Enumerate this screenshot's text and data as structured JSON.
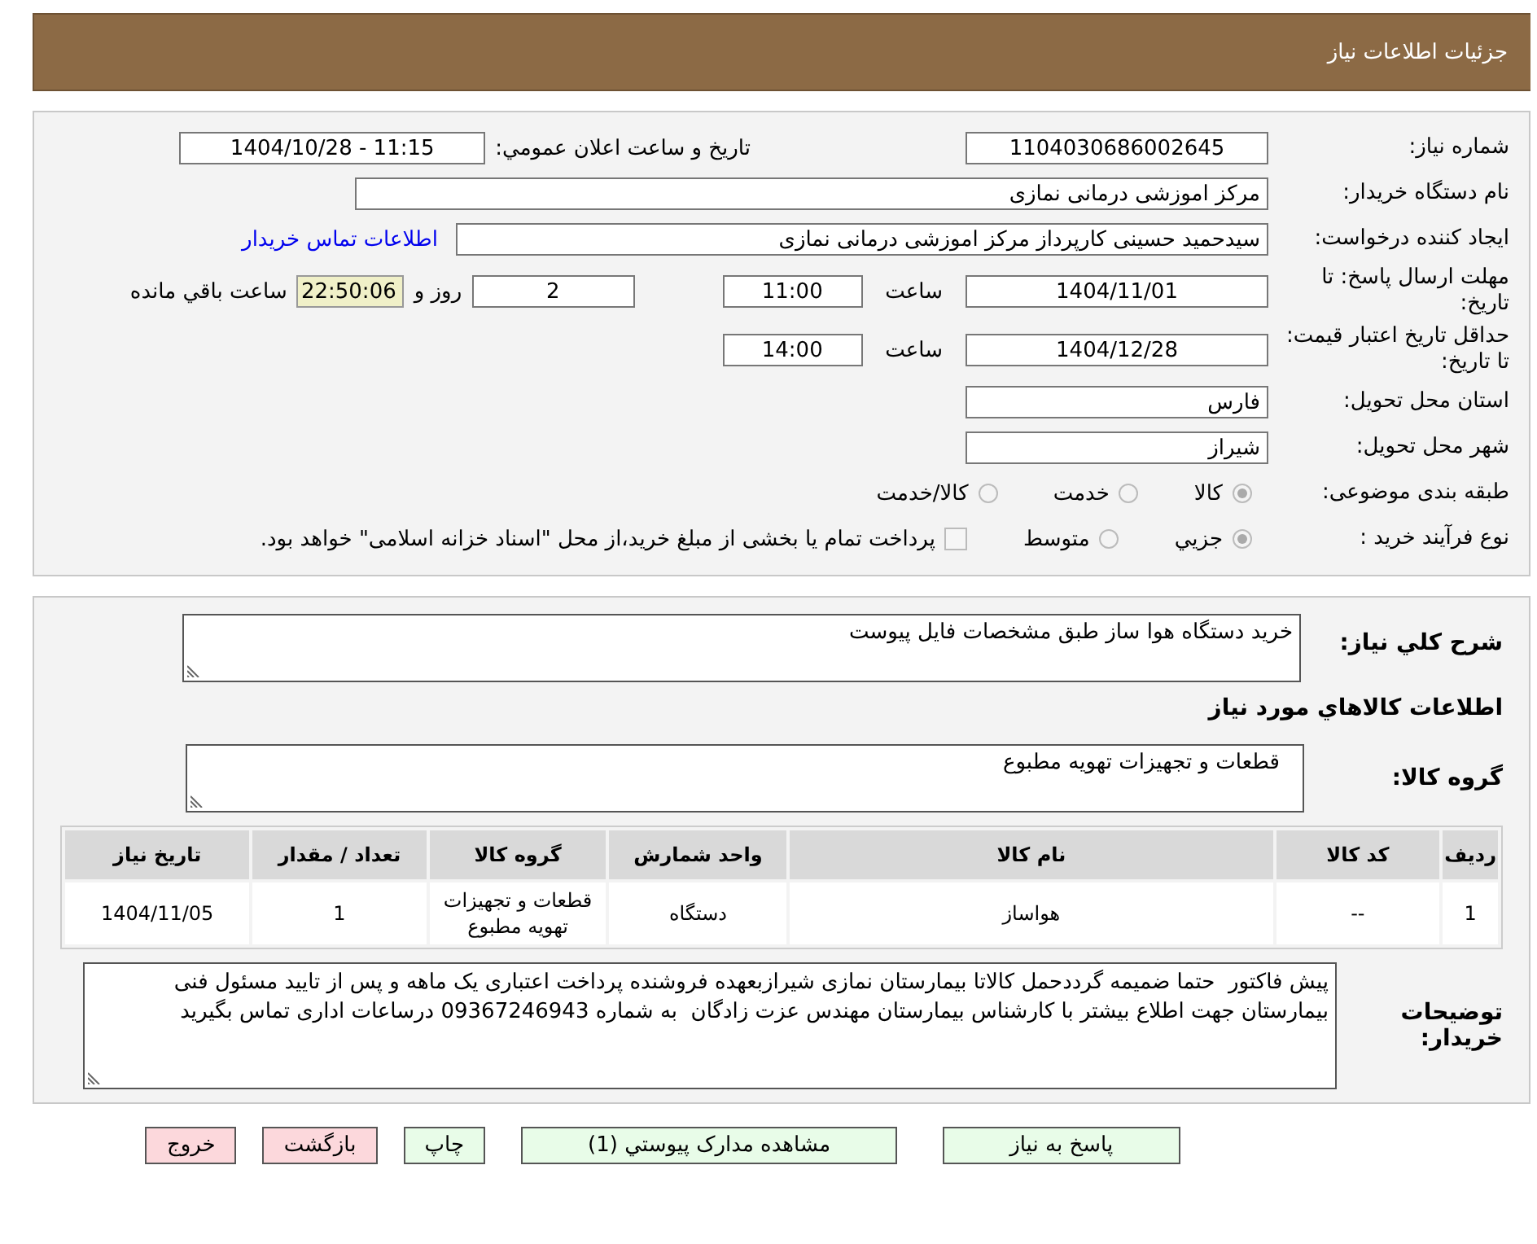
{
  "header": {
    "title": "جزئیات اطلاعات نیاز"
  },
  "details": {
    "need_number": {
      "label": "شماره نیاز:",
      "value": "1104030686002645"
    },
    "announce_datetime": {
      "label": "تاریخ و ساعت اعلان عمومي:",
      "value": "1404/10/28 - 11:15"
    },
    "buyer_org": {
      "label": "نام دستگاه خريدار:",
      "value": "مرکز اموزشی درمانی نمازی"
    },
    "requester": {
      "label": "ايجاد کننده درخواست:",
      "value": "سیدحمید حسینی کارپرداز مرکز اموزشی درمانی نمازی"
    },
    "contact_link": "اطلاعات تماس خريدار",
    "reply_deadline": {
      "label": "مهلت ارسال پاسخ: تا تاريخ:",
      "date": "1404/11/01",
      "time_label": "ساعت",
      "time": "11:00",
      "days": "2",
      "days_label": "روز و",
      "remaining": "22:50:06",
      "remaining_label": "ساعت باقي مانده"
    },
    "price_validity": {
      "label": "حداقل تاريخ اعتبار قيمت: تا تاريخ:",
      "date": "1404/12/28",
      "time_label": "ساعت",
      "time": "14:00"
    },
    "province": {
      "label": "استان محل تحويل:",
      "value": "فارس"
    },
    "city": {
      "label": "شهر محل تحويل:",
      "value": "شیراز"
    },
    "category": {
      "label": "طبقه بندی موضوعی:",
      "options": [
        {
          "label": "کالا",
          "selected": true
        },
        {
          "label": "خدمت",
          "selected": false
        },
        {
          "label": "کالا/خدمت",
          "selected": false
        }
      ]
    },
    "process": {
      "label": "نوع فرآيند خريد :",
      "options": [
        {
          "label": "جزيي",
          "selected": true
        },
        {
          "label": "متوسط",
          "selected": false
        }
      ],
      "payment": {
        "checked": false,
        "text": "پرداخت تمام يا بخشی از مبلغ خريد،از محل \"اسناد خزانه اسلامی\" خواهد بود."
      }
    }
  },
  "goods": {
    "summary": {
      "label": "شرح کلي نياز:",
      "value": "خرید دستگاه هوا ساز طبق مشخصات فایل پیوست"
    },
    "heading": "اطلاعات کالاهاي مورد نياز",
    "goods_group": {
      "label": "گروه کالا:",
      "value": "قطعات و تجهیزات تهویه مطبوع"
    },
    "table": {
      "columns": [
        "رديف",
        "کد کالا",
        "نام کالا",
        "واحد شمارش",
        "گروه کالا",
        "تعداد / مقدار",
        "تاريخ نياز"
      ],
      "rows": [
        [
          "1",
          "--",
          "هواساز",
          "دستگاه",
          "قطعات و تجهیزات تهویه مطبوع",
          "1",
          "1404/11/05"
        ]
      ]
    },
    "buyer_notes": {
      "label": "توضيحات خريدار:",
      "value": "پیش فاکتور  حتما ضمیمه گرددحمل کالاتا بیمارستان نمازی شیرازبعهده فروشنده پرداخت اعتباری یک ماهه و پس از تایید مسئول فنی بیمارستان جهت اطلاع بیشتر با کارشناس بیمارستان مهندس عزت زادگان  به شماره 09367246943 درساعات اداری تماس بگیرید"
    }
  },
  "buttons": [
    {
      "label": "پاسخ به نياز",
      "kind": "normal"
    },
    {
      "label": "مشاهده مدارک پيوستي (1)",
      "kind": "normal"
    },
    {
      "label": "چاپ",
      "kind": "normal"
    },
    {
      "label": "بازگشت",
      "kind": "danger"
    },
    {
      "label": "خروج",
      "kind": "danger"
    }
  ]
}
